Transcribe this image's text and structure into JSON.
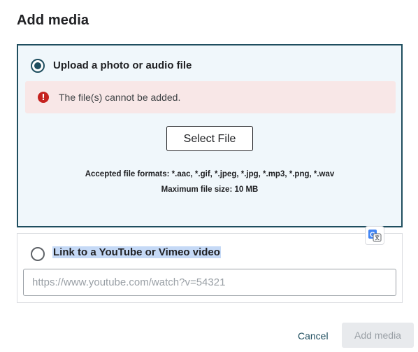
{
  "dialog": {
    "title": "Add media"
  },
  "upload_option": {
    "label": "Upload a photo or audio file",
    "selected": true,
    "error": {
      "icon": "exclamation-circle-icon",
      "text": "The(file)s cannot be added."
    },
    "select_file_label": "Select File",
    "accepted_formats": "Accepted file formats: *.aac, *.gif, *.jpeg, *.jpg, *.mp3, *.png, *.wav",
    "max_size": "Maximum file size: 10 MB"
  },
  "link_option": {
    "label": "Link to a YouTube or Vimeo video",
    "selected": false,
    "input_placeholder": "https://www.youtube.com/watch?v=54321",
    "input_value": ""
  },
  "translate_icon": "google-translate-icon",
  "footer": {
    "cancel_label": "Cancel",
    "add_label": "Add media",
    "add_disabled": true
  },
  "colors": {
    "accent": "#1f4e5f",
    "error_bg": "#f8e7e7",
    "error_icon": "#c5221f",
    "selection_highlight": "#c5d9f6"
  }
}
